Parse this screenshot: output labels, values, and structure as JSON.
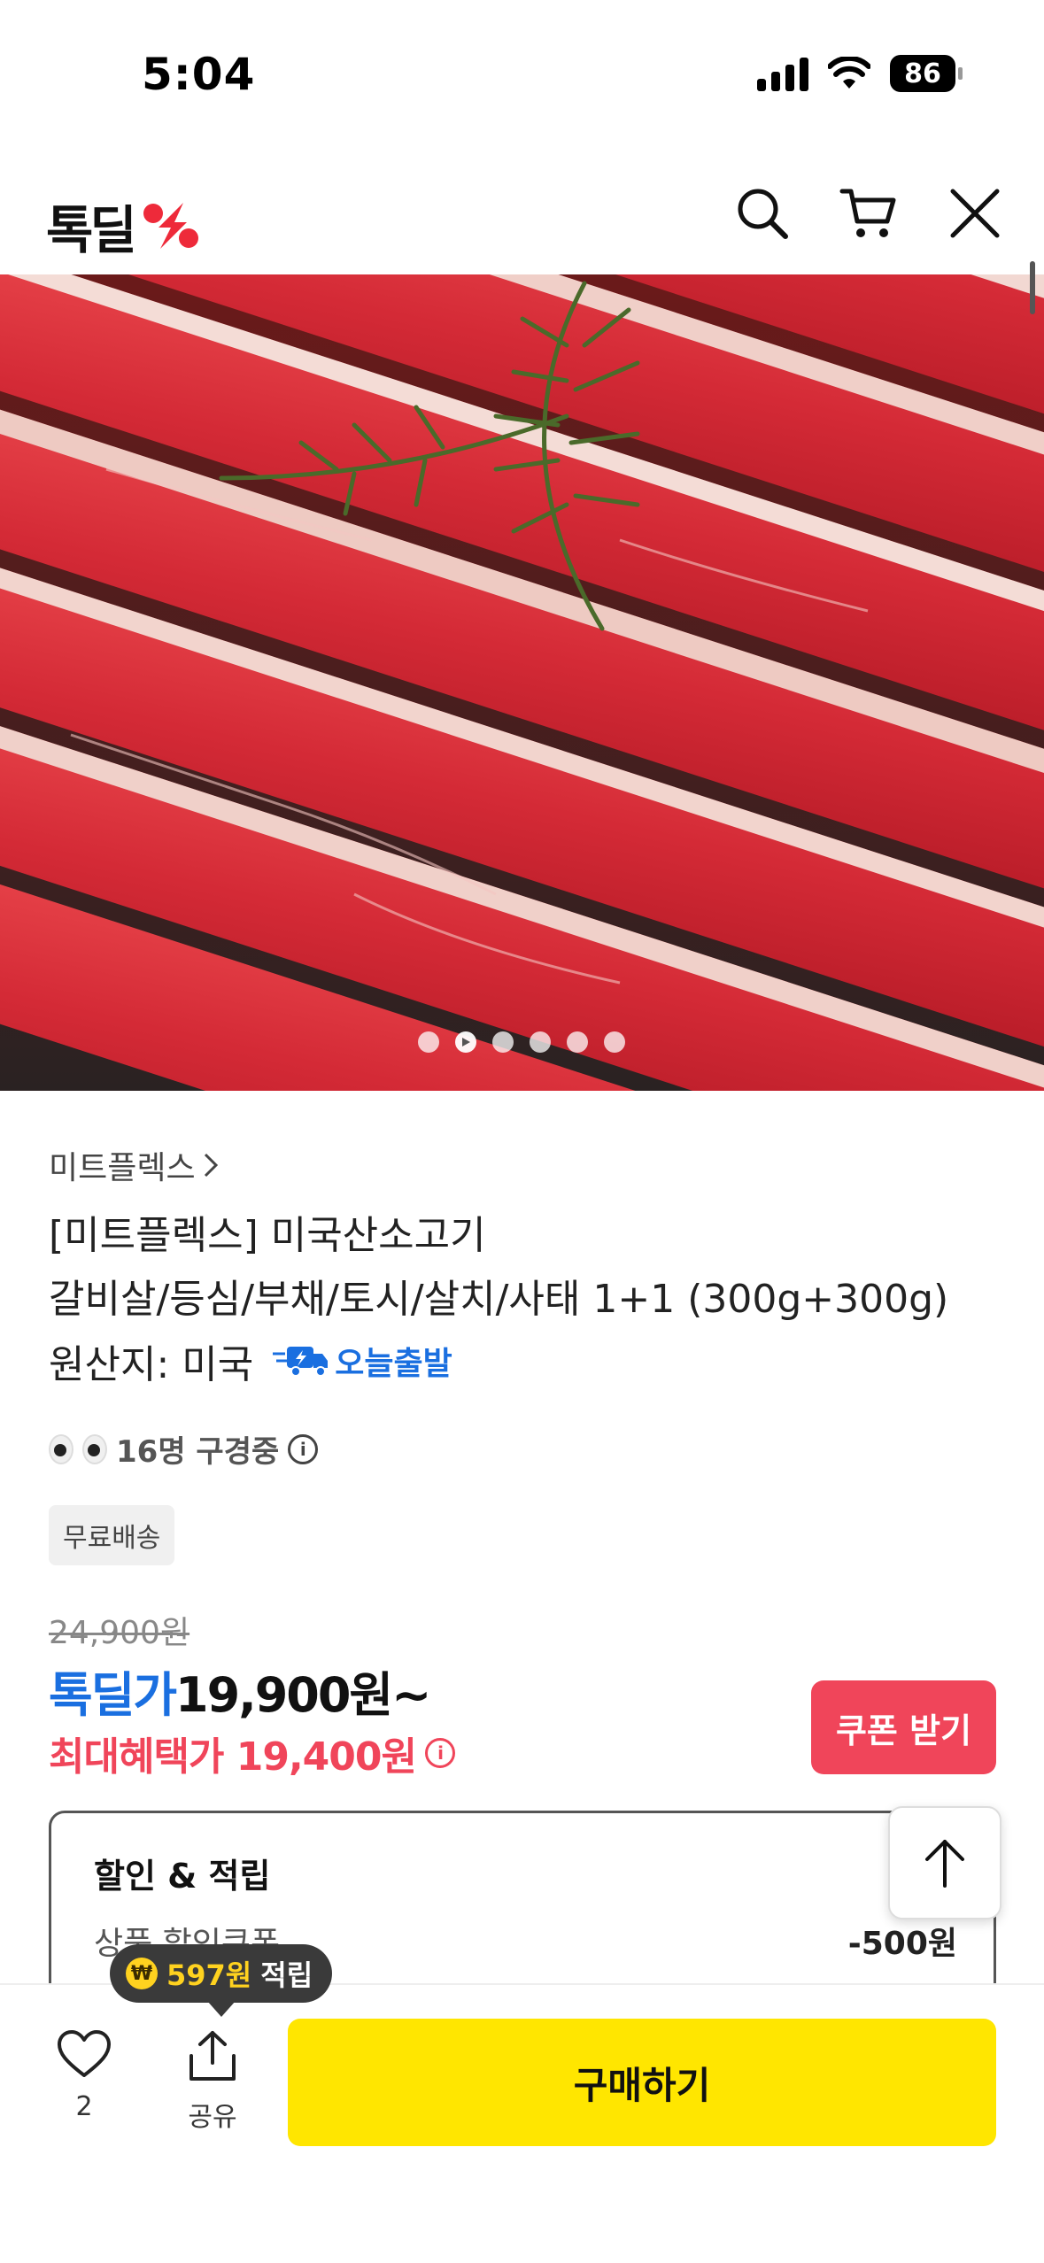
{
  "status_bar": {
    "time": "5:04",
    "battery": "86"
  },
  "header": {
    "logo_text": "톡딜"
  },
  "gallery": {
    "image_count": 6,
    "current_index": 1
  },
  "product": {
    "brand": "미트플렉스",
    "title_line1": "[미트플렉스] 미국산소고기",
    "title_line2": "갈비살/등심/부채/토시/살치/사태 1+1 (300g+300g)",
    "origin": "원산지: 미국",
    "delivery_badge": "오늘출발",
    "viewers": "16명 구경중",
    "shipping_tag": "무료배송"
  },
  "price": {
    "original": "24,900원",
    "deal_label": "톡딜가",
    "deal_price": "19,900원~",
    "max_benefit": "최대혜택가 19,400원",
    "coupon_button": "쿠폰 받기"
  },
  "discount": {
    "title": "할인 & 적립",
    "row_label": "상품 할인쿠폰",
    "row_amount": "-500원"
  },
  "bottom": {
    "like_count": "2",
    "share_label": "공유",
    "buy_button": "구매하기",
    "points_amount": "597원",
    "points_label": "적립"
  },
  "colors": {
    "accent_blue": "#1a6fe0",
    "accent_red": "#f0455a",
    "buy_yellow": "#ffe600"
  }
}
